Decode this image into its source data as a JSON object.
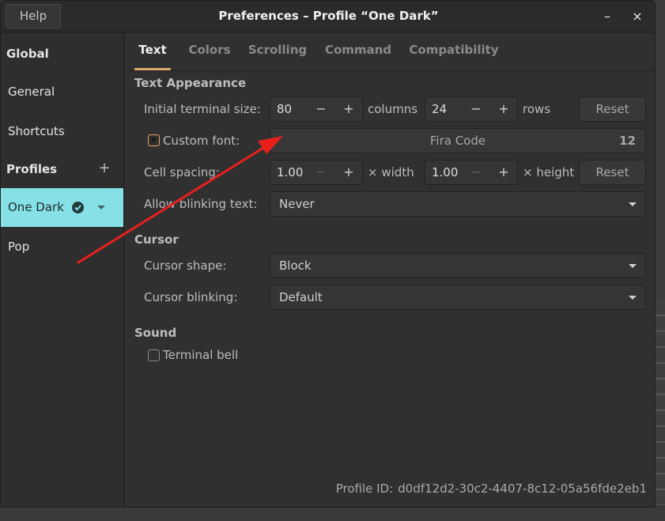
{
  "window": {
    "title": "Preferences – Profile “One Dark”",
    "help_label": "Help",
    "minimize_glyph": "–",
    "close_glyph": "×"
  },
  "sidebar": {
    "global_header": "Global",
    "items": [
      {
        "label": "General"
      },
      {
        "label": "Shortcuts"
      }
    ],
    "profiles_header": "Profiles",
    "add_glyph": "+",
    "profiles": [
      {
        "label": "One Dark",
        "selected": true,
        "default": true
      },
      {
        "label": "Pop",
        "selected": false
      }
    ]
  },
  "tabs": [
    {
      "label": "Text",
      "active": true
    },
    {
      "label": "Colors",
      "active": false
    },
    {
      "label": "Scrolling",
      "active": false
    },
    {
      "label": "Command",
      "active": false
    },
    {
      "label": "Compatibility",
      "active": false
    }
  ],
  "text_appearance": {
    "section_title": "Text Appearance",
    "initial_size": {
      "label": "Initial terminal size:",
      "columns_value": "80",
      "columns_unit": "columns",
      "rows_value": "24",
      "rows_unit": "rows",
      "minus": "−",
      "plus": "+",
      "reset_label": "Reset"
    },
    "custom_font": {
      "label": "Custom font:",
      "checked": true,
      "font_name": "Fira Code",
      "font_size": "12"
    },
    "cell_spacing": {
      "label": "Cell spacing:",
      "width_value": "1.00",
      "width_unit": "× width",
      "height_value": "1.00",
      "height_unit": "× height",
      "reset_label": "Reset"
    },
    "blinking_text": {
      "label": "Allow blinking text:",
      "value": "Never"
    }
  },
  "cursor": {
    "section_title": "Cursor",
    "shape": {
      "label": "Cursor shape:",
      "value": "Block"
    },
    "blinking": {
      "label": "Cursor blinking:",
      "value": "Default"
    }
  },
  "sound": {
    "section_title": "Sound",
    "terminal_bell": {
      "label": "Terminal bell",
      "checked": false
    }
  },
  "profile_id": {
    "label": "Profile ID:",
    "value": "d0df12d2-30c2-4407-8c12-05a56fde2eb1"
  },
  "colors": {
    "accent": "#dfa96a",
    "selection": "#86e1e6",
    "annotation_arrow": "#e8201c"
  }
}
